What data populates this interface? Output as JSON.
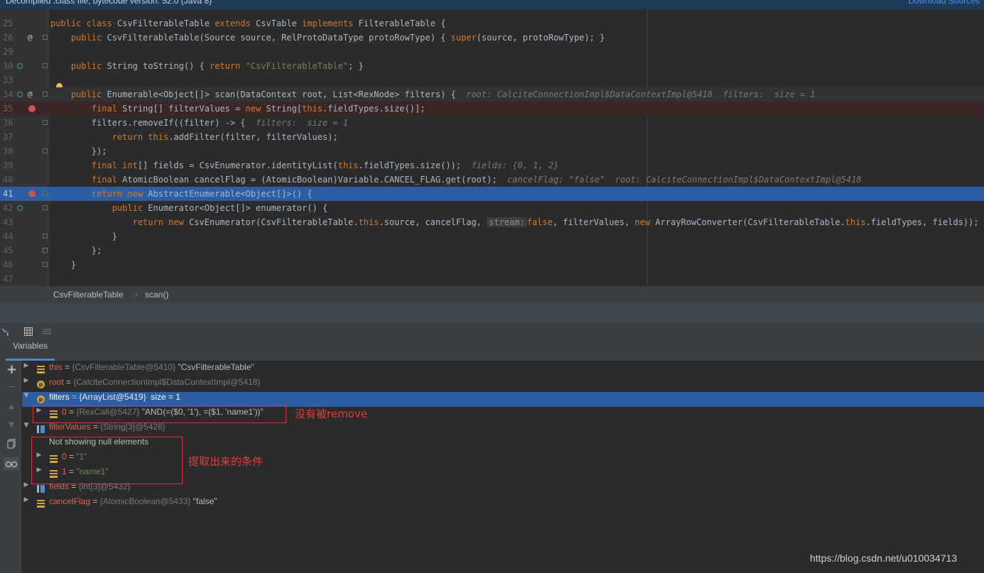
{
  "header": {
    "decompiled_notice": "Decompiled .class file, bytecode version: 52.0 (Java 8)",
    "download_sources": "Download Sources"
  },
  "code_lines": [
    {
      "num": "25",
      "parts": [
        [
          "kw",
          "public class "
        ],
        [
          "p",
          "CsvFilterableTable "
        ],
        [
          "kw",
          "extends "
        ],
        [
          "p",
          "CsvTable "
        ],
        [
          "kw",
          "implements "
        ],
        [
          "p",
          "FilterableTable {"
        ]
      ]
    },
    {
      "num": "26",
      "parts": [
        [
          "p",
          "    "
        ],
        [
          "kw",
          "public "
        ],
        [
          "p",
          "CsvFilterableTable(Source source, RelProtoDataType protoRowType) { "
        ],
        [
          "kw",
          "super"
        ],
        [
          "p",
          "(source, protoRowType); }"
        ]
      ]
    },
    {
      "num": "29",
      "parts": []
    },
    {
      "num": "30",
      "parts": [
        [
          "p",
          "    "
        ],
        [
          "kw",
          "public "
        ],
        [
          "p",
          "String toString() { "
        ],
        [
          "kw",
          "return "
        ],
        [
          "st",
          "\"CsvFilterableTable\""
        ],
        [
          "p",
          "; }"
        ]
      ]
    },
    {
      "num": "33",
      "parts": []
    },
    {
      "num": "34",
      "parts": [
        [
          "p",
          "    "
        ],
        [
          "kw",
          "public "
        ],
        [
          "p",
          "Enumerable<Object[]> scan(DataContext root, List<RexNode> filters) {  "
        ],
        [
          "hint",
          "root: CalciteConnectionImpl$DataContextImpl@5418  filters:  size = 1"
        ]
      ]
    },
    {
      "num": "35",
      "parts": [
        [
          "p",
          "        "
        ],
        [
          "kw",
          "final "
        ],
        [
          "p",
          "String[] filterValues = "
        ],
        [
          "kw",
          "new "
        ],
        [
          "p",
          "String["
        ],
        [
          "kw",
          "this"
        ],
        [
          "p",
          ".fieldTypes.size()];"
        ]
      ]
    },
    {
      "num": "36",
      "parts": [
        [
          "p",
          "        filters.removeIf((filter) -> {  "
        ],
        [
          "hint",
          "filters:  size = 1"
        ]
      ]
    },
    {
      "num": "37",
      "parts": [
        [
          "p",
          "            "
        ],
        [
          "kw",
          "return this"
        ],
        [
          "p",
          ".addFilter(filter, filterValues);"
        ]
      ]
    },
    {
      "num": "38",
      "parts": [
        [
          "p",
          "        });"
        ]
      ]
    },
    {
      "num": "39",
      "parts": [
        [
          "p",
          "        "
        ],
        [
          "kw",
          "final int"
        ],
        [
          "p",
          "[] fields = CsvEnumerator.identityList("
        ],
        [
          "kw",
          "this"
        ],
        [
          "p",
          ".fieldTypes.size());  "
        ],
        [
          "hint",
          "fields: {0, 1, 2}"
        ]
      ]
    },
    {
      "num": "40",
      "parts": [
        [
          "p",
          "        "
        ],
        [
          "kw",
          "final "
        ],
        [
          "p",
          "AtomicBoolean cancelFlag = (AtomicBoolean)Variable.CANCEL_FLAG.get(root);  "
        ],
        [
          "hint",
          "cancelFlag: \"false\"  root: CalciteConnectionImpl$DataContextImpl@5418"
        ]
      ]
    },
    {
      "num": "41",
      "parts": [
        [
          "p",
          "        "
        ],
        [
          "kw",
          "return new "
        ],
        [
          "p",
          "AbstractEnumerable<Object[]>() {"
        ]
      ]
    },
    {
      "num": "42",
      "parts": [
        [
          "p",
          "            "
        ],
        [
          "kw",
          "public "
        ],
        [
          "p",
          "Enumerator<Object[]> enumerator() {"
        ]
      ]
    },
    {
      "num": "43",
      "parts": [
        [
          "p",
          "                "
        ],
        [
          "kw",
          "return new "
        ],
        [
          "p",
          "CsvEnumerator(CsvFilterableTable."
        ],
        [
          "kw",
          "this"
        ],
        [
          "p",
          ".source, cancelFlag, "
        ],
        [
          "pill",
          "stream:"
        ],
        [
          "kw",
          "false"
        ],
        [
          "p",
          ", filterValues, "
        ],
        [
          "kw",
          "new "
        ],
        [
          "p",
          "ArrayRowConverter(CsvFilterableTable."
        ],
        [
          "kw",
          "this"
        ],
        [
          "p",
          ".fieldTypes, fields));"
        ]
      ]
    },
    {
      "num": "44",
      "parts": [
        [
          "p",
          "            }"
        ]
      ]
    },
    {
      "num": "45",
      "parts": [
        [
          "p",
          "        };"
        ]
      ]
    },
    {
      "num": "46",
      "parts": [
        [
          "p",
          "    }"
        ]
      ]
    },
    {
      "num": "47",
      "parts": []
    }
  ],
  "breadcrumbs": {
    "class_name": "CsvFilterableTable",
    "method": "scan()",
    "sep": "›"
  },
  "debugger": {
    "tab_label": "Variables",
    "variables": [
      {
        "name": "this",
        "type": "{CsvFilterableTable@5410}",
        "value": "\"CsvFilterableTable\"",
        "icon": "field",
        "expand": "collapsed",
        "indent": 0,
        "selected": false
      },
      {
        "name": "root",
        "type": "{CalciteConnectionImpl$DataContextImpl@5418}",
        "value": "",
        "icon": "param",
        "expand": "collapsed",
        "indent": 0,
        "selected": false
      },
      {
        "name": "filters",
        "type": "{ArrayList@5419}",
        "value": " size = 1",
        "icon": "param",
        "expand": "expanded",
        "indent": 0,
        "selected": true
      },
      {
        "name": "0",
        "type": "{RexCall@5427}",
        "value": "\"AND(=($0, '1'), =($1, 'name1'))\"",
        "icon": "field",
        "expand": "collapsed",
        "indent": 1,
        "selected": false
      },
      {
        "name": "filterValues",
        "type": "{String[3]@5428}",
        "value": "",
        "icon": "arr",
        "expand": "expanded",
        "indent": 0,
        "selected": false
      },
      {
        "plain": "Not showing null elements",
        "indent": 1
      },
      {
        "name": "0",
        "type": "",
        "value": "\"1\"",
        "icon": "field",
        "expand": "collapsed",
        "indent": 1,
        "selected": false,
        "str": true
      },
      {
        "name": "1",
        "type": "",
        "value": "\"name1\"",
        "icon": "field",
        "expand": "collapsed",
        "indent": 1,
        "selected": false,
        "str": true
      },
      {
        "name": "fields",
        "type": "{int[3]@5432}",
        "value": "",
        "icon": "arr",
        "expand": "collapsed",
        "indent": 0,
        "selected": false
      },
      {
        "name": "cancelFlag",
        "type": "{AtomicBoolean@5433}",
        "value": "\"false\"",
        "icon": "field",
        "expand": "collapsed",
        "indent": 0,
        "selected": false
      }
    ],
    "eq": " = "
  },
  "annotations": {
    "not_removed": "没有被remove",
    "extracted_conditions": "提取出来的条件"
  },
  "watermark": "https://blog.csdn.net/u010034713",
  "icons": {
    "left_toolbar": [
      "plus-icon",
      "minus-icon",
      "arrow-up-icon",
      "arrow-down-icon",
      "copy-icon",
      "glasses-icon"
    ]
  }
}
